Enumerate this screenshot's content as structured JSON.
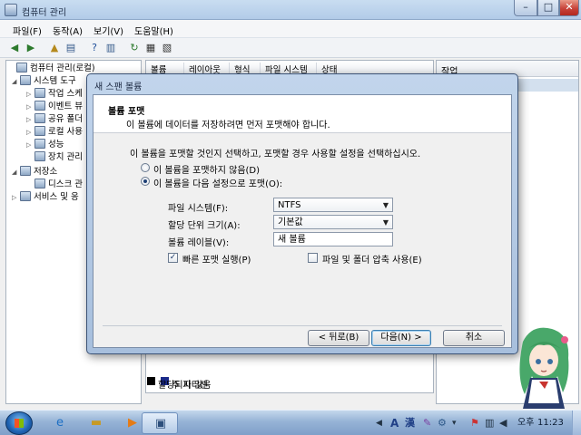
{
  "main_window": {
    "title": "컴퓨터 관리",
    "menu": [
      "파일(F)",
      "동작(A)",
      "보기(V)",
      "도움말(H)"
    ],
    "tree": [
      {
        "label": "컴퓨터 관리(로컬)",
        "level": 0,
        "expander": ""
      },
      {
        "label": "시스템 도구",
        "level": 1,
        "expander": "◢"
      },
      {
        "label": "작업 스케",
        "level": 2,
        "expander": "▷"
      },
      {
        "label": "이벤트 뷰",
        "level": 2,
        "expander": "▷"
      },
      {
        "label": "공유 폴더",
        "level": 2,
        "expander": "▷"
      },
      {
        "label": "로컬 사용",
        "level": 2,
        "expander": "▷"
      },
      {
        "label": "성능",
        "level": 2,
        "expander": "▷"
      },
      {
        "label": "장치 관리",
        "level": 2,
        "expander": ""
      },
      {
        "label": "저장소",
        "level": 1,
        "expander": "◢"
      },
      {
        "label": "디스크 관",
        "level": 2,
        "expander": ""
      },
      {
        "label": "서비스 및 응",
        "level": 1,
        "expander": "▷"
      }
    ],
    "columns": [
      "볼륨",
      "레이아웃",
      "형식",
      "파일 시스템",
      "상태"
    ],
    "actions_header": "작업",
    "legend": [
      {
        "label": "할당되지 않음",
        "color": "#000000"
      },
      {
        "label": "주 파티션",
        "color": "#1a2a8a"
      }
    ]
  },
  "dialog": {
    "title": "새 스팬 볼륨",
    "heading": "볼륨 포맷",
    "subheading": "이 볼륨에 데이터를 저장하려면 먼저 포맷해야 합니다.",
    "instruction": "이 볼륨을 포맷할 것인지 선택하고, 포맷할 경우 사용할 설정을 선택하십시오.",
    "radio_no_format": "이 볼륨을 포맷하지 않음(D)",
    "radio_format": "이 볼륨을 다음 설정으로 포맷(O):",
    "fs_label": "파일 시스템(F):",
    "fs_value": "NTFS",
    "alloc_label": "할당 단위 크기(A):",
    "alloc_value": "기본값",
    "vol_label": "볼륨 레이블(V):",
    "vol_value": "새 볼륨",
    "quick_format": "빠른 포맷 실행(P)",
    "compress": "파일 및 폴더 압축 사용(E)",
    "back_button": "< 뒤로(B)",
    "next_button": "다음(N) >",
    "cancel_button": "취소"
  },
  "taskbar": {
    "ime_a": "A",
    "ime_han": "漢",
    "ampm": "오후",
    "time": "11:23"
  },
  "colors": {
    "accent": "#3c7fb1",
    "title_bar": "#b2cbe8"
  }
}
